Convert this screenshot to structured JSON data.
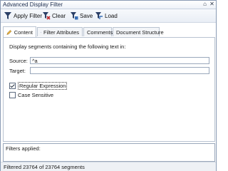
{
  "window": {
    "title": "Advanced Display Filter",
    "pin_glyph": "⌂",
    "close_glyph": "✕"
  },
  "toolbar": {
    "apply_label": "Apply Filter",
    "clear_label": "Clear",
    "save_label": "Save",
    "load_label": "Load",
    "icons": [
      "filter-icon",
      "clear-filter-icon",
      "save-filter-icon",
      "load-filter-icon"
    ]
  },
  "tabs": [
    {
      "label": "Content",
      "icon": "pencil-icon",
      "active": true
    },
    {
      "label": "Filter Attributes",
      "icon": "filter-icon",
      "active": false
    },
    {
      "label": "Comments",
      "active": false
    },
    {
      "label": "Document Structure",
      "active": false
    }
  ],
  "content": {
    "description": "Display segments containing the following text in:",
    "source_label": "Source:",
    "source_value": "^a",
    "target_label": "Target:",
    "target_value": "",
    "regex_label": "Regular Expression",
    "regex_checked": true,
    "case_label": "Case Sensitive",
    "case_checked": false
  },
  "applied": {
    "label": "Filters applied:"
  },
  "status": {
    "text": "Filtered 23764 of 23764 segments"
  },
  "colors": {
    "accent": "#1f3a6e",
    "border": "#9aa8bb"
  }
}
